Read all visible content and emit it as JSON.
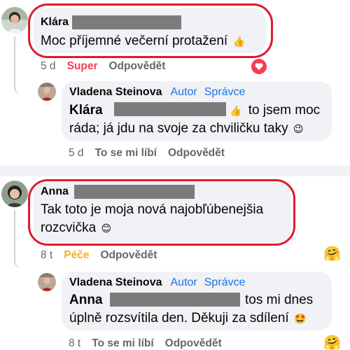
{
  "comment1": {
    "author": "Klára",
    "text": "Moc příjemné večerní protažení",
    "emoji": "👍",
    "time": "5 d",
    "reaction_label": "Super",
    "reply_label": "Odpovědět"
  },
  "reply1": {
    "author": "Vladena Steinova",
    "badges": [
      "Autor",
      "Správce"
    ],
    "mention": "Klára",
    "emoji_mid": "👍",
    "text_part1": "to jsem moc",
    "text_part2": "ráda; já jdu na svoje za chviličku taky",
    "emoji_end": "😉",
    "time": "5 d",
    "like_label": "To se mi líbí",
    "reply_label": "Odpovědět"
  },
  "comment2": {
    "author": "Anna",
    "text_line1": "Tak toto je moja nová najobľúbenejšia",
    "text_line2": "rozcvička",
    "emoji": "😊",
    "time": "8 t",
    "reaction_label": "Péče",
    "reply_label": "Odpovědět",
    "reaction_emoji": "🤗"
  },
  "reply2": {
    "author": "Vladena Steinova",
    "badges": [
      "Autor",
      "Správce"
    ],
    "mention": "Anna",
    "text_part1": "tos mi dnes",
    "text_part2": "úplně rozsvítila den. Děkuji za sdílení",
    "emoji_end": "🤩",
    "time": "8 t",
    "like_label": "To se mi líbí",
    "reply_label": "Odpovědět",
    "reaction_emoji": "🤗"
  },
  "colors": {
    "highlight": "#e1192b",
    "super": "#f33e58",
    "care": "#f7b125",
    "badge": "#1b74e4",
    "bubble": "#f0f2f5"
  },
  "icons": [
    "heart-reaction-icon",
    "care-reaction-icon",
    "thumbs-up-emoji",
    "wink-emoji",
    "smile-emoji",
    "star-struck-emoji"
  ]
}
